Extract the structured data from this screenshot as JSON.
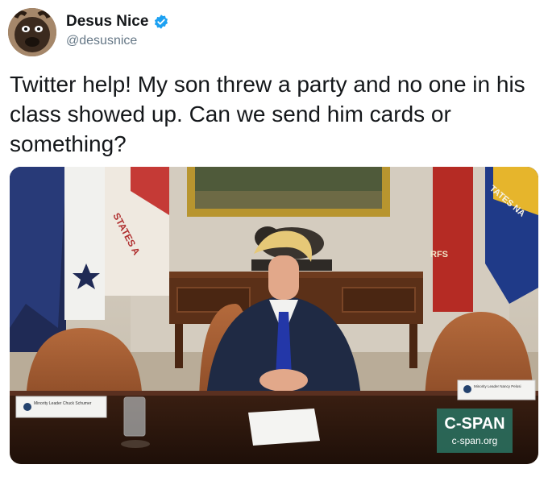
{
  "author": {
    "display_name": "Desus Nice",
    "handle": "@desusnice",
    "verified": true,
    "avatar_icon": "avatar-dog-photo"
  },
  "tweet": {
    "text": "Twitter help! My son threw a party and no one in his class showed up. Can we send him cards or something?"
  },
  "media": {
    "icon": "photo-oval-office-meeting",
    "flag_lettering_left": "STATES A",
    "flag_lettering_right": "TATES NA",
    "flag_lettering_rfs": "RFS",
    "nameplate_left": "Minority Leader Chuck Schumer",
    "nameplate_right": "Minority Leader Nancy Pelosi",
    "watermark": {
      "brand": "C-SPAN",
      "url": "c-span.org"
    }
  },
  "colors": {
    "verified_blue": "#1da1f2",
    "handle_gray": "#657786",
    "cspan_green": "#2a6d5c"
  }
}
